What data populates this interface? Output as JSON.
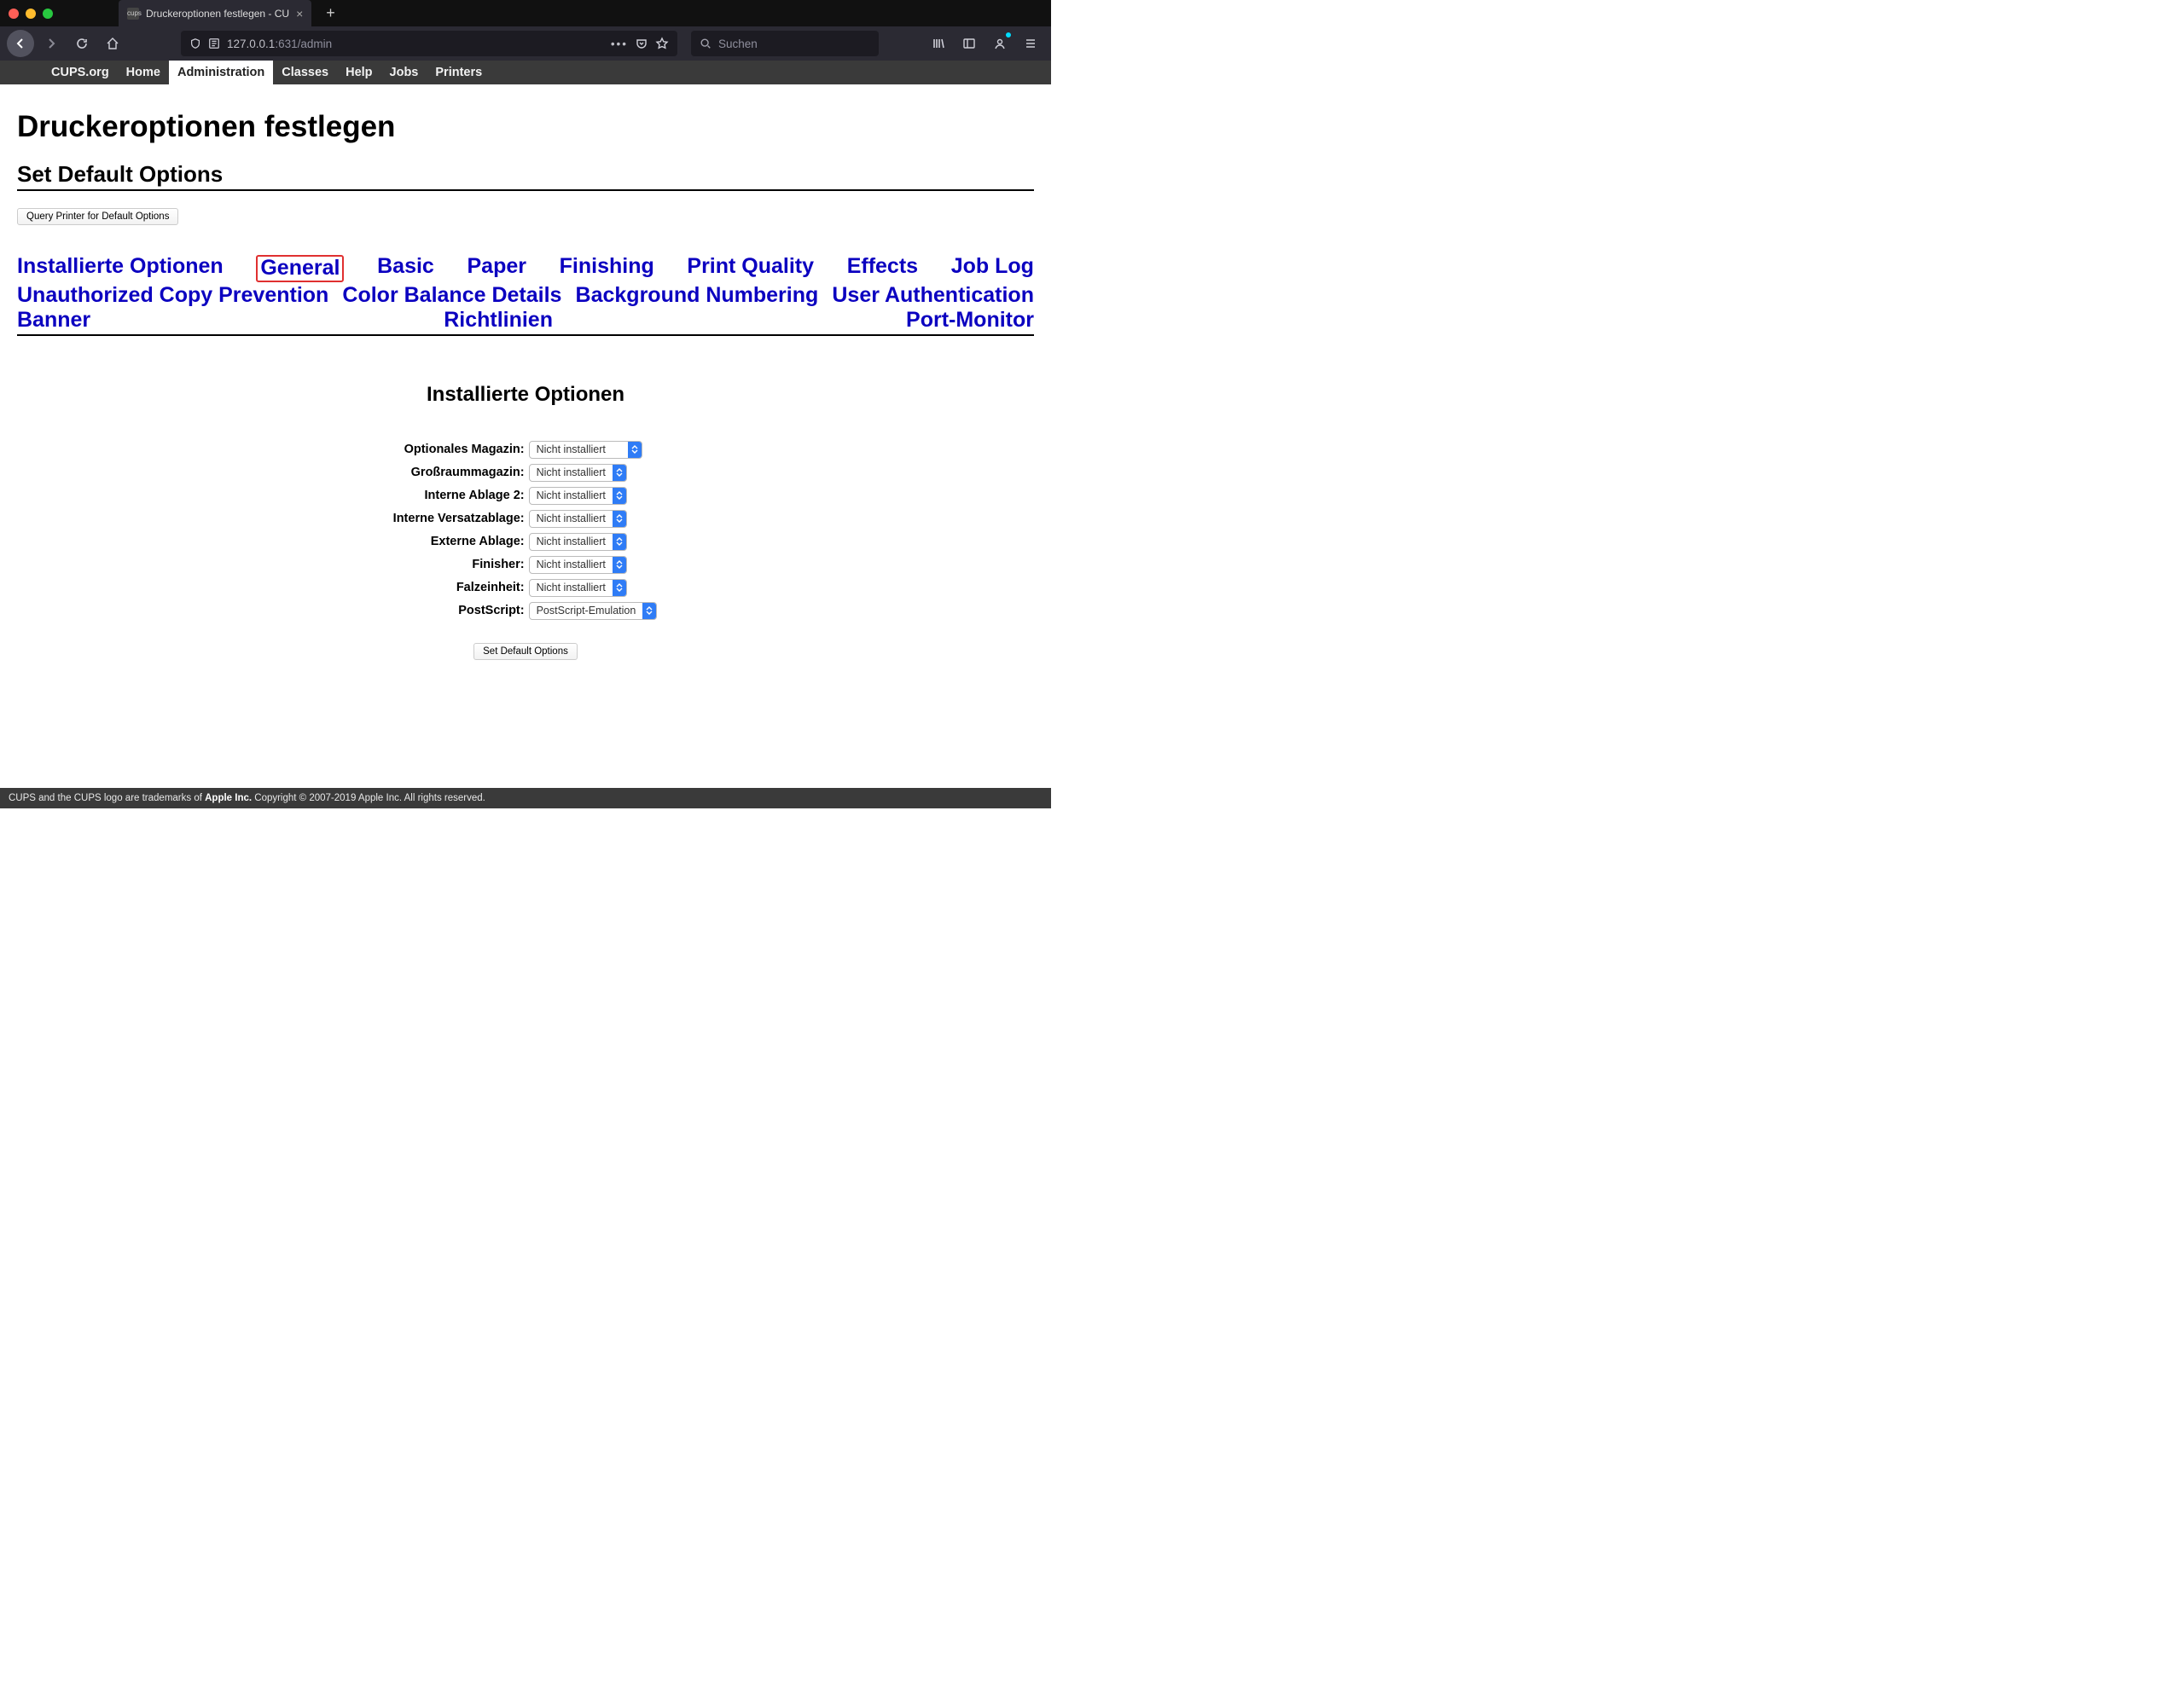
{
  "browser": {
    "tab_title": "Druckeroptionen festlegen - CU",
    "url_host": "127.0.0.1",
    "url_port_path": ":631/admin",
    "search_placeholder": "Suchen"
  },
  "nav": {
    "items": [
      {
        "label": "CUPS.org",
        "active": false
      },
      {
        "label": "Home",
        "active": false
      },
      {
        "label": "Administration",
        "active": true
      },
      {
        "label": "Classes",
        "active": false
      },
      {
        "label": "Help",
        "active": false
      },
      {
        "label": "Jobs",
        "active": false
      },
      {
        "label": "Printers",
        "active": false
      }
    ]
  },
  "page": {
    "h1": "Druckeroptionen festlegen",
    "h2": "Set Default Options",
    "query_button": "Query Printer for Default Options",
    "tabs": [
      "Installierte Optionen",
      "General",
      "Basic",
      "Paper",
      "Finishing",
      "Print Quality",
      "Effects",
      "Job Log",
      "Unauthorized Copy Prevention",
      "Color Balance Details",
      "Background Numbering",
      "User Authentication",
      "Banner",
      "Richtlinien",
      "Port-Monitor"
    ],
    "highlighted_tab_index": 1,
    "section_heading": "Installierte Optionen",
    "options": [
      {
        "label": "Optionales Magazin:",
        "value": "Nicht installiert",
        "wide": true
      },
      {
        "label": "Großraummagazin:",
        "value": "Nicht installiert",
        "wide": false
      },
      {
        "label": "Interne Ablage 2:",
        "value": "Nicht installiert",
        "wide": false
      },
      {
        "label": "Interne Versatzablage:",
        "value": "Nicht installiert",
        "wide": false
      },
      {
        "label": "Externe Ablage:",
        "value": "Nicht installiert",
        "wide": false
      },
      {
        "label": "Finisher:",
        "value": "Nicht installiert",
        "wide": false
      },
      {
        "label": "Falzeinheit:",
        "value": "Nicht installiert",
        "wide": false
      },
      {
        "label": "PostScript:",
        "value": "PostScript-Emulation",
        "wide": false
      }
    ],
    "set_default_button": "Set Default Options"
  },
  "footer": {
    "prefix": "CUPS and the CUPS logo are trademarks of ",
    "owner": "Apple Inc.",
    "suffix": " Copyright © 2007-2019 Apple Inc. All rights reserved."
  }
}
